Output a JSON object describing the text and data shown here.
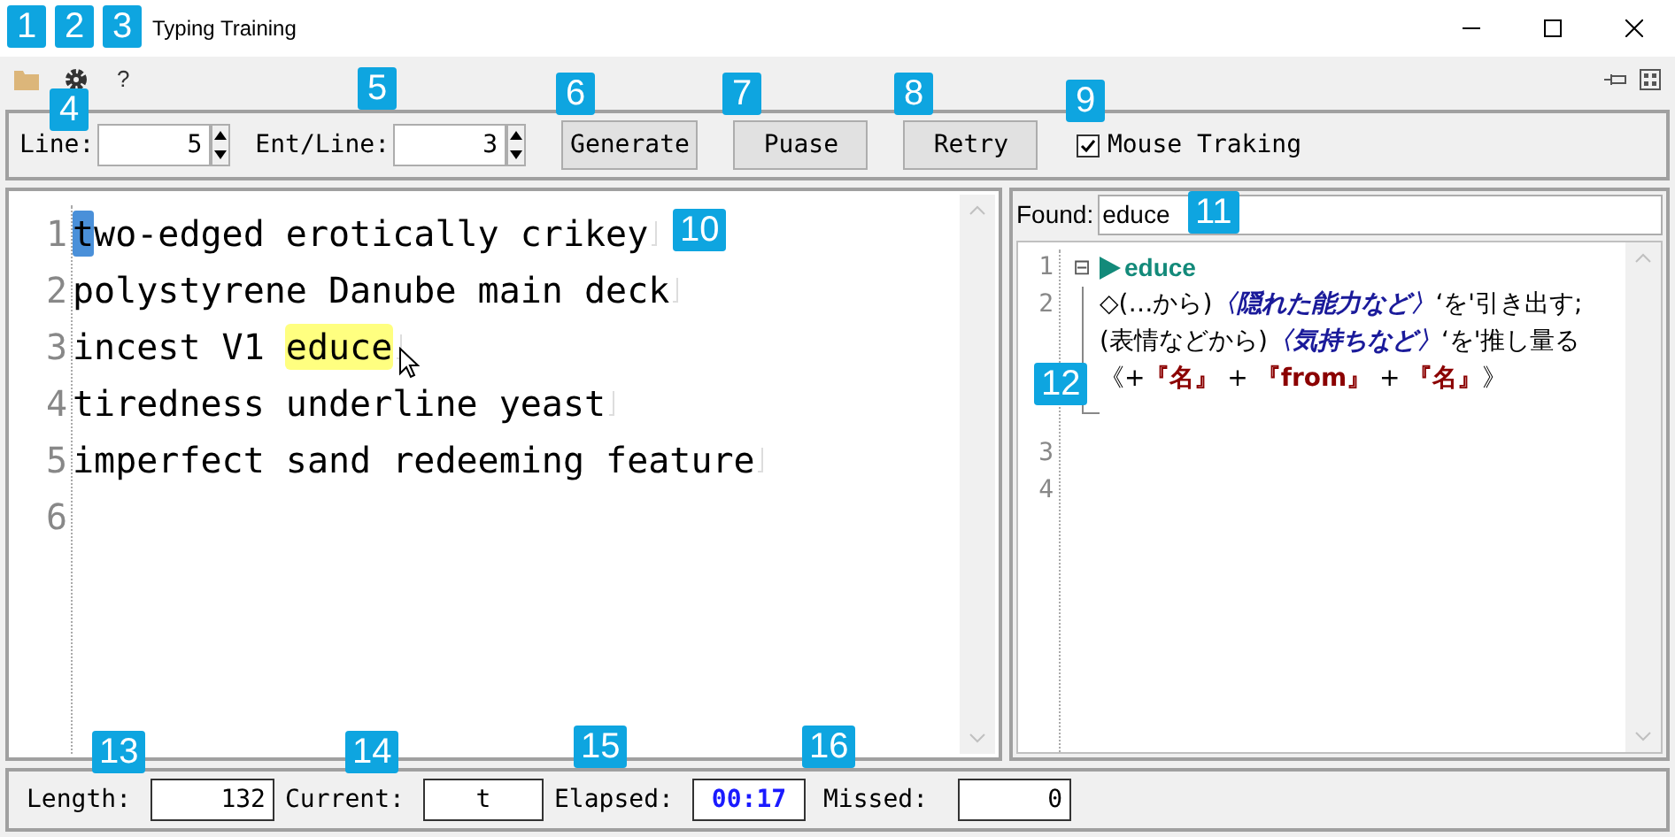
{
  "window": {
    "title_end": "Typing Training"
  },
  "toolbar": {
    "help": "?"
  },
  "controls": {
    "line_label": "Line:",
    "line_value": "5",
    "ent_label": "Ent/Line:",
    "ent_value": "3",
    "buttons": [
      "Generate",
      "Puase",
      "Retry"
    ],
    "mouse_tracking": {
      "label": "Mouse Traking",
      "checked": true
    }
  },
  "editor": {
    "lines": [
      {
        "number": "1",
        "segments": [
          {
            "kind": "cursor",
            "text": "t"
          },
          {
            "kind": "plain",
            "text": "wo-edged erotically crikey"
          }
        ]
      },
      {
        "number": "2",
        "segments": [
          {
            "kind": "plain",
            "text": "polystyrene Danube main deck"
          }
        ]
      },
      {
        "number": "3",
        "segments": [
          {
            "kind": "plain",
            "text": "incest V1 "
          },
          {
            "kind": "found",
            "text": "educe"
          }
        ]
      },
      {
        "number": "4",
        "segments": [
          {
            "kind": "plain",
            "text": "tiredness underline yeast"
          }
        ]
      },
      {
        "number": "5",
        "segments": [
          {
            "kind": "plain",
            "text": "imperfect sand redeeming feature"
          }
        ]
      },
      {
        "number": "6"
      }
    ]
  },
  "dictionary": {
    "found_label": "Found:",
    "found_value": "educe",
    "line_numbers": [
      "1",
      "2",
      "3",
      "4"
    ],
    "headword": "educe",
    "collapse": "⊟",
    "definition": [
      {
        "kind": "plain",
        "text": "◇(…から)"
      },
      {
        "kind": "note",
        "text": "〈隠れた能力など〉"
      },
      {
        "kind": "plain",
        "text": "‘を'引き出す;(表情などから)"
      },
      {
        "kind": "note",
        "text": "〈気持ちなど〉"
      },
      {
        "kind": "plain",
        "text": "‘を'推し量る《+"
      },
      {
        "kind": "pattern",
        "text": "『名』"
      },
      {
        "kind": "plain",
        "text": " + "
      },
      {
        "kind": "pattern",
        "text": "『from』"
      },
      {
        "kind": "plain",
        "text": " + "
      },
      {
        "kind": "pattern",
        "text": "『名』"
      },
      {
        "kind": "plain",
        "text": "》"
      }
    ]
  },
  "status": [
    {
      "label": "Length:",
      "value": "132",
      "kind": "plain"
    },
    {
      "label": "Current:",
      "value": "t",
      "kind": "center"
    },
    {
      "label": "Elapsed:",
      "value": "00:17",
      "kind": "timer"
    },
    {
      "label": "Missed:",
      "value": "0",
      "kind": "plain"
    }
  ],
  "callouts": [
    "1",
    "2",
    "3",
    "4",
    "5",
    "6",
    "7",
    "8",
    "9",
    "10",
    "11",
    "12",
    "13",
    "14",
    "15",
    "16"
  ]
}
